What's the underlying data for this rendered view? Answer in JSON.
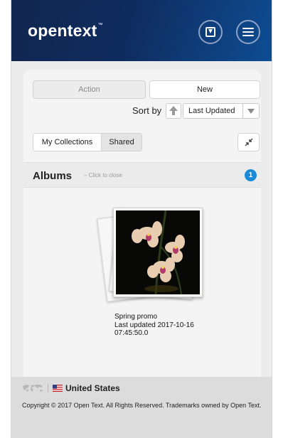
{
  "header": {
    "logo_text": "opentext",
    "logo_tm": "™",
    "download_icon": "download-icon",
    "menu_icon": "hamburger-menu-icon"
  },
  "toolbar": {
    "action_label": "Action",
    "new_label": "New",
    "sort_by_label": "Sort by",
    "sort_value": "Last Updated",
    "sort_direction_icon": "arrow-up-icon",
    "sort_caret_icon": "caret-down-icon"
  },
  "tabs": [
    {
      "label": "My Collections",
      "selected": false
    },
    {
      "label": "Shared",
      "selected": true
    }
  ],
  "collapse_icon": "collapse-arrows-icon",
  "albums": {
    "title": "Albums",
    "close_hint": "– Click to close",
    "count": "1",
    "items": [
      {
        "name": "Spring promo",
        "updated": "Last updated 2017-10-16 07:45:50.0",
        "thumbnail": "orchid-photo"
      }
    ]
  },
  "footer": {
    "world_icon": "world-map-icon",
    "flag_icon": "us-flag-icon",
    "country": "United States",
    "copyright": "Copyright © 2017 Open Text. All Rights Reserved. Trademarks owned by Open Text."
  },
  "colors": {
    "header_dark": "#11264f",
    "header_light": "#0e4d93",
    "badge_blue": "#1a8ad8",
    "page_bg": "#ececec",
    "footer_bg": "#dcdcdc"
  }
}
